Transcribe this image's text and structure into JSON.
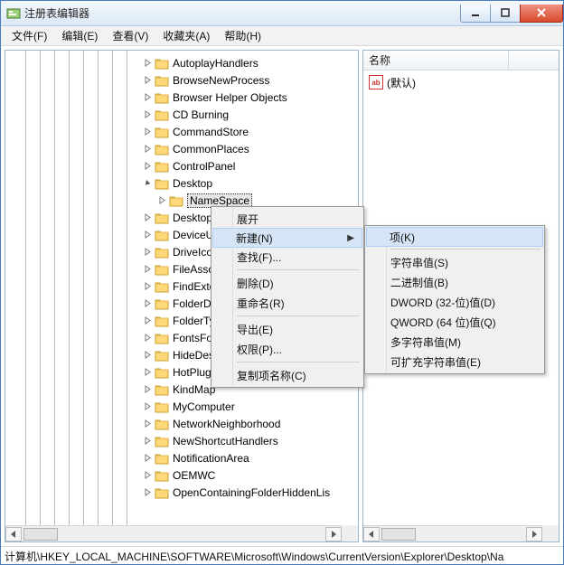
{
  "window": {
    "title": "注册表编辑器"
  },
  "menubar": [
    "文件(F)",
    "编辑(E)",
    "查看(V)",
    "收藏夹(A)",
    "帮助(H)"
  ],
  "tree": {
    "items": [
      {
        "label": "AutoplayHandlers",
        "open": false,
        "depth": 0
      },
      {
        "label": "BrowseNewProcess",
        "open": false,
        "depth": 0
      },
      {
        "label": "Browser Helper Objects",
        "open": false,
        "depth": 0
      },
      {
        "label": "CD Burning",
        "open": false,
        "depth": 0
      },
      {
        "label": "CommandStore",
        "open": false,
        "depth": 0
      },
      {
        "label": "CommonPlaces",
        "open": false,
        "depth": 0
      },
      {
        "label": "ControlPanel",
        "open": false,
        "depth": 0
      },
      {
        "label": "Desktop",
        "open": true,
        "depth": 0
      },
      {
        "label": "NameSpace",
        "open": false,
        "depth": 1,
        "selected": true
      },
      {
        "label": "DesktopI",
        "open": false,
        "depth": 0
      },
      {
        "label": "DeviceUp",
        "open": false,
        "depth": 0
      },
      {
        "label": "DriveIcon",
        "open": false,
        "depth": 0
      },
      {
        "label": "FileAssoc",
        "open": false,
        "depth": 0
      },
      {
        "label": "FindExten",
        "open": false,
        "depth": 0
      },
      {
        "label": "FolderDe",
        "open": false,
        "depth": 0
      },
      {
        "label": "FolderTyp",
        "open": false,
        "depth": 0
      },
      {
        "label": "FontsFold",
        "open": false,
        "depth": 0
      },
      {
        "label": "HideDesk",
        "open": false,
        "depth": 0
      },
      {
        "label": "HotPlugN",
        "open": false,
        "depth": 0
      },
      {
        "label": "KindMap",
        "open": false,
        "depth": 0
      },
      {
        "label": "MyComputer",
        "open": false,
        "depth": 0
      },
      {
        "label": "NetworkNeighborhood",
        "open": false,
        "depth": 0
      },
      {
        "label": "NewShortcutHandlers",
        "open": false,
        "depth": 0
      },
      {
        "label": "NotificationArea",
        "open": false,
        "depth": 0
      },
      {
        "label": "OEMWC",
        "open": false,
        "depth": 0
      },
      {
        "label": "OpenContainingFolderHiddenLis",
        "open": false,
        "depth": 0
      }
    ]
  },
  "right": {
    "header": "名称",
    "default_value_icon": "ab",
    "default_value_label": "(默认)"
  },
  "status": "计算机\\HKEY_LOCAL_MACHINE\\SOFTWARE\\Microsoft\\Windows\\CurrentVersion\\Explorer\\Desktop\\Na",
  "ctxmenu": {
    "items": [
      {
        "label": "展开",
        "kind": "item"
      },
      {
        "label": "新建(N)",
        "kind": "item",
        "submenu": true,
        "hover": true
      },
      {
        "label": "查找(F)...",
        "kind": "item"
      },
      {
        "kind": "sep"
      },
      {
        "label": "删除(D)",
        "kind": "item"
      },
      {
        "label": "重命名(R)",
        "kind": "item"
      },
      {
        "kind": "sep"
      },
      {
        "label": "导出(E)",
        "kind": "item"
      },
      {
        "label": "权限(P)...",
        "kind": "item"
      },
      {
        "kind": "sep"
      },
      {
        "label": "复制项名称(C)",
        "kind": "item"
      }
    ]
  },
  "submenu": {
    "items": [
      {
        "label": "项(K)",
        "hover": true
      },
      {
        "kind": "sep"
      },
      {
        "label": "字符串值(S)"
      },
      {
        "label": "二进制值(B)"
      },
      {
        "label": "DWORD (32-位)值(D)"
      },
      {
        "label": "QWORD (64 位)值(Q)"
      },
      {
        "label": "多字符串值(M)"
      },
      {
        "label": "可扩充字符串值(E)"
      }
    ]
  }
}
